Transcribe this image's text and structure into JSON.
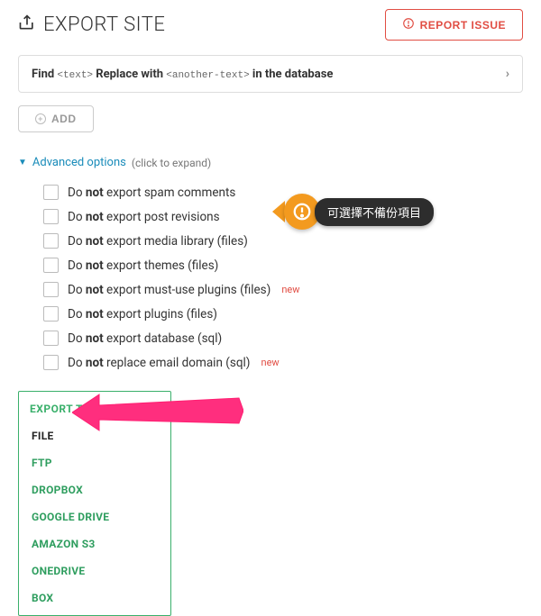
{
  "header": {
    "title": "EXPORT SITE",
    "report_label": "REPORT ISSUE"
  },
  "find_replace": {
    "prefix": "Find",
    "tag1": "<text>",
    "mid": "Replace with",
    "tag2": "<another-text>",
    "suffix": "in the database"
  },
  "add_button": {
    "label": "ADD"
  },
  "advanced": {
    "label": "Advanced options",
    "hint": "(click to expand)",
    "options": [
      {
        "pre": "Do ",
        "bold": "not",
        "post": " export spam comments",
        "new": false
      },
      {
        "pre": "Do ",
        "bold": "not",
        "post": " export post revisions",
        "new": false
      },
      {
        "pre": "Do ",
        "bold": "not",
        "post": " export media library (files)",
        "new": false
      },
      {
        "pre": "Do ",
        "bold": "not",
        "post": " export themes (files)",
        "new": false
      },
      {
        "pre": "Do ",
        "bold": "not",
        "post": " export must-use plugins (files)",
        "new": true
      },
      {
        "pre": "Do ",
        "bold": "not",
        "post": " export plugins (files)",
        "new": false
      },
      {
        "pre": "Do ",
        "bold": "not",
        "post": " export database (sql)",
        "new": false
      },
      {
        "pre": "Do ",
        "bold": "not",
        "post": " replace email domain (sql)",
        "new": true
      }
    ]
  },
  "export": {
    "header": "EXPORT TO",
    "items": [
      "FILE",
      "FTP",
      "DROPBOX",
      "GOOGLE DRIVE",
      "AMAZON S3",
      "ONEDRIVE",
      "BOX"
    ]
  },
  "callout": {
    "text": "可選擇不備份項目"
  },
  "new_label": "new"
}
